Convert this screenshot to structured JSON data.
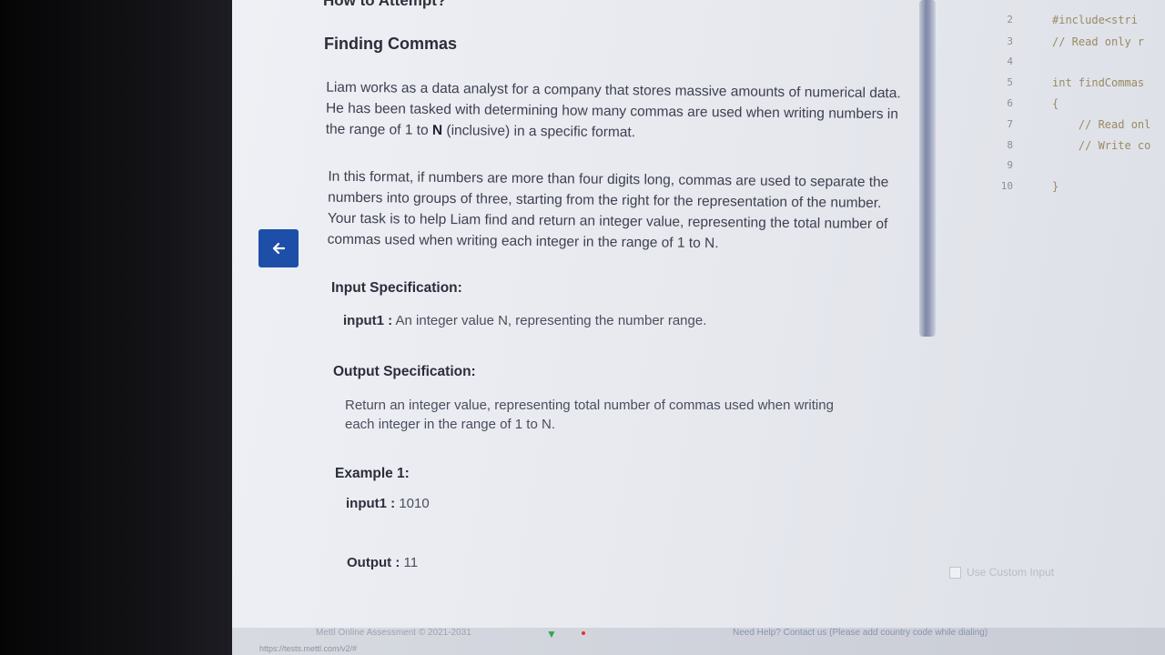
{
  "header": {
    "how_to": "How to Attempt?"
  },
  "problem": {
    "title": "Finding Commas",
    "para1_before": "Liam works as a data analyst for a company that stores massive amounts of numerical data. He has been tasked with determining how many commas are used when writing numbers in the range of 1 to ",
    "para1_bold": "N",
    "para1_after": " (inclusive) in a specific format.",
    "para2": "In this format, if numbers are more than four digits long, commas are used to separate the numbers into groups of three, starting from the right for the representation of the number. Your task is to help Liam find and return an integer value, representing the total number of commas used when writing each integer in the range of 1 to N.",
    "input_spec_heading": "Input Specification:",
    "input_spec_key": "input1 :",
    "input_spec_value": "An integer value N, representing the number range.",
    "output_spec_heading": "Output Specification:",
    "output_spec_line1": "Return an integer value, representing total number of commas used when writing",
    "output_spec_line2": "each integer in the range of 1 to N.",
    "example_heading": "Example 1:",
    "example_input_key": "input1 :",
    "example_input_value": "1010",
    "example_output_key": "Output :",
    "example_output_value": "11"
  },
  "editor": {
    "line_numbers": [
      "2",
      "3",
      "4",
      "5",
      "6",
      "7",
      "8",
      "9",
      "10"
    ],
    "code_lines": [
      "#include<stri",
      "// Read only r",
      "",
      "int findCommas",
      "{",
      "    // Read onl",
      "    // Write co",
      "",
      "}"
    ]
  },
  "custom_input_label": "Use Custom Input",
  "footer": {
    "copyright": "Mettl Online Assessment © 2021-2031",
    "help": "Need Help? Contact us (Please add country code while dialing)",
    "url": "https://tests.mettl.com/v2/#"
  },
  "colors": {
    "accent": "#1d4fa8",
    "background": "#e9ebf0"
  },
  "icons": {
    "back": "arrow-left-icon",
    "wifi": "wifi-icon"
  }
}
